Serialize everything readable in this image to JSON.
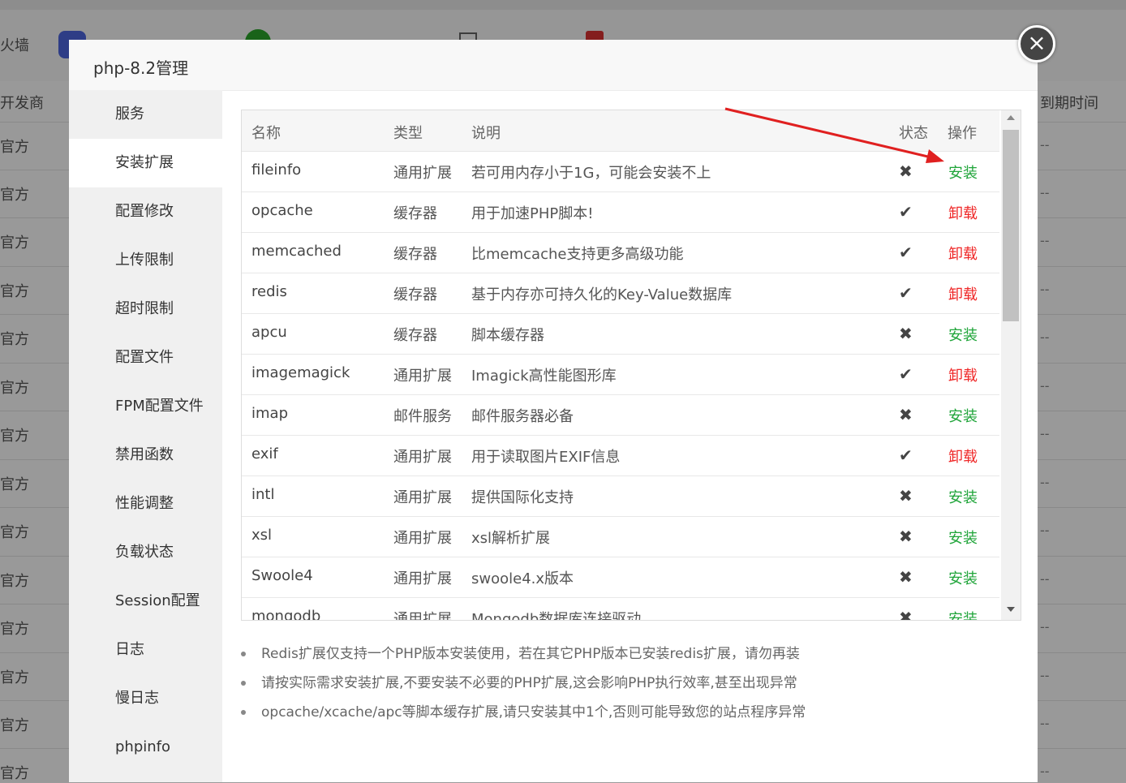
{
  "background": {
    "toolbar_items": [
      "火墙",
      "...",
      "...",
      "...",
      "..."
    ],
    "toolbar_first": "火墙",
    "header_left": "开发商",
    "header_right": "到期时间",
    "row_label": "官方",
    "row_dash": "--"
  },
  "modal": {
    "title": "php-8.2管理",
    "close_symbol": "×",
    "sidebar": [
      {
        "label": "服务"
      },
      {
        "label": "安装扩展"
      },
      {
        "label": "配置修改"
      },
      {
        "label": "上传限制"
      },
      {
        "label": "超时限制"
      },
      {
        "label": "配置文件"
      },
      {
        "label": "FPM配置文件"
      },
      {
        "label": "禁用函数"
      },
      {
        "label": "性能调整"
      },
      {
        "label": "负载状态"
      },
      {
        "label": "Session配置"
      },
      {
        "label": "日志"
      },
      {
        "label": "慢日志"
      },
      {
        "label": "phpinfo"
      }
    ],
    "active_sidebar": "安装扩展",
    "table": {
      "headers": {
        "name": "名称",
        "type": "类型",
        "desc": "说明",
        "status": "状态",
        "action": "操作"
      },
      "rows": [
        {
          "name": "fileinfo",
          "type": "通用扩展",
          "desc": "若可用内存小于1G，可能会安装不上",
          "status": "✖",
          "installed": false,
          "action": "安装"
        },
        {
          "name": "opcache",
          "type": "缓存器",
          "desc": "用于加速PHP脚本!",
          "status": "✔",
          "installed": true,
          "action": "卸载"
        },
        {
          "name": "memcached",
          "type": "缓存器",
          "desc": "比memcache支持更多高级功能",
          "status": "✔",
          "installed": true,
          "action": "卸载"
        },
        {
          "name": "redis",
          "type": "缓存器",
          "desc": "基于内存亦可持久化的Key-Value数据库",
          "status": "✔",
          "installed": true,
          "action": "卸载"
        },
        {
          "name": "apcu",
          "type": "缓存器",
          "desc": "脚本缓存器",
          "status": "✖",
          "installed": false,
          "action": "安装"
        },
        {
          "name": "imagemagick",
          "type": "通用扩展",
          "desc": "Imagick高性能图形库",
          "status": "✔",
          "installed": true,
          "action": "卸载"
        },
        {
          "name": "imap",
          "type": "邮件服务",
          "desc": "邮件服务器必备",
          "status": "✖",
          "installed": false,
          "action": "安装"
        },
        {
          "name": "exif",
          "type": "通用扩展",
          "desc": "用于读取图片EXIF信息",
          "status": "✔",
          "installed": true,
          "action": "卸载"
        },
        {
          "name": "intl",
          "type": "通用扩展",
          "desc": "提供国际化支持",
          "status": "✖",
          "installed": false,
          "action": "安装"
        },
        {
          "name": "xsl",
          "type": "通用扩展",
          "desc": "xsl解析扩展",
          "status": "✖",
          "installed": false,
          "action": "安装"
        },
        {
          "name": "Swoole4",
          "type": "通用扩展",
          "desc": "swoole4.x版本",
          "status": "✖",
          "installed": false,
          "action": "安装"
        },
        {
          "name": "mongodb",
          "type": "通用扩展",
          "desc": "Mongodb数据库连接驱动",
          "status": "✖",
          "installed": false,
          "action": "安装"
        }
      ]
    },
    "tips": [
      "Redis扩展仅支持一个PHP版本安装使用，若在其它PHP版本已安装redis扩展，请勿再装",
      "请按实际需求安装扩展,不要安装不必要的PHP扩展,这会影响PHP执行效率,甚至出现异常",
      "opcache/xcache/apc等脚本缓存扩展,请只安装其中1个,否则可能导致您的站点程序异常"
    ]
  },
  "colors": {
    "install": "#20a53a",
    "uninstall": "#ef2828",
    "annotation_arrow": "#e02020"
  }
}
